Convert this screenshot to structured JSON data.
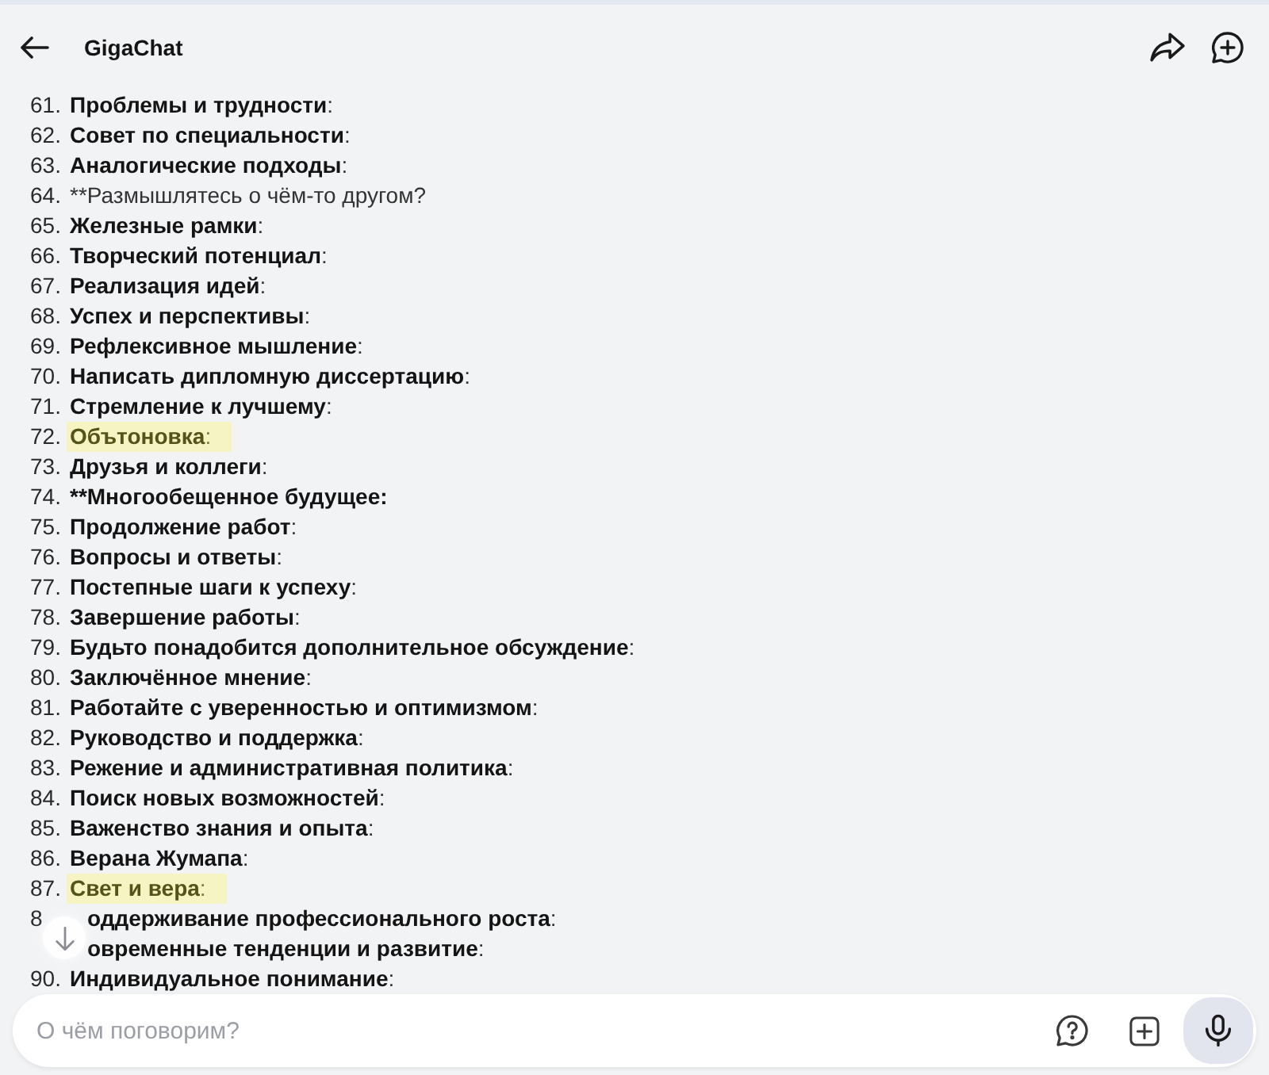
{
  "header": {
    "title": "GigaChat"
  },
  "list": [
    {
      "kind": "item",
      "number": "61.",
      "bold_text": "Проблемы и трудности",
      "plain_text": ":",
      "highlighted": false
    },
    {
      "kind": "item",
      "number": "62.",
      "bold_text": "Совет по специальности",
      "plain_text": ":",
      "highlighted": false
    },
    {
      "kind": "item",
      "number": "63.",
      "bold_text": "Аналогические подходы",
      "plain_text": ":",
      "highlighted": false
    },
    {
      "kind": "item",
      "number": "64.",
      "plain_text": "**Размышлятесь о чём-то другом?",
      "highlighted": false
    },
    {
      "kind": "item",
      "number": "65.",
      "bold_text": "Железные рамки",
      "plain_text": ":",
      "highlighted": false
    },
    {
      "kind": "item",
      "number": "66.",
      "bold_text": "Творческий потенциал",
      "plain_text": ":",
      "highlighted": false
    },
    {
      "kind": "item",
      "number": "67.",
      "bold_text": "Реализация идей",
      "plain_text": ":",
      "highlighted": false
    },
    {
      "kind": "item",
      "number": "68.",
      "bold_text": "Успех и перспективы",
      "plain_text": ":",
      "highlighted": false
    },
    {
      "kind": "item",
      "number": "69.",
      "bold_text": "Рефлексивное мышление",
      "plain_text": ":",
      "highlighted": false
    },
    {
      "kind": "item",
      "number": "70.",
      "bold_text": "Написать дипломную диссертацию",
      "plain_text": ":",
      "highlighted": false
    },
    {
      "kind": "item",
      "number": "71.",
      "bold_text": "Стремление к лучшему",
      "plain_text": ":",
      "highlighted": false
    },
    {
      "kind": "item",
      "number": "72.",
      "bold_text": "Обътоновка",
      "plain_text": ":",
      "highlighted": true
    },
    {
      "kind": "item",
      "number": "73.",
      "bold_text": "Друзья и коллеги",
      "plain_text": ":",
      "highlighted": false
    },
    {
      "kind": "item",
      "number": "74.",
      "bold_text": "**Многообещенное будущее:",
      "highlighted": false
    },
    {
      "kind": "item",
      "number": "75.",
      "bold_text": "Продолжение работ",
      "plain_text": ":",
      "highlighted": false
    },
    {
      "kind": "item",
      "number": "76.",
      "bold_text": "Вопросы и ответы",
      "plain_text": ":",
      "highlighted": false
    },
    {
      "kind": "item",
      "number": "77.",
      "bold_text": "Постепные шаги к успеху",
      "plain_text": ":",
      "highlighted": false
    },
    {
      "kind": "item",
      "number": "78.",
      "bold_text": "Завершение работы",
      "plain_text": ":",
      "highlighted": false
    },
    {
      "kind": "item",
      "number": "79.",
      "bold_text": "Будьто понадобится дополнительное обсуждение",
      "plain_text": ":",
      "highlighted": false
    },
    {
      "kind": "item",
      "number": "80.",
      "bold_text": "Заключённое мнение",
      "plain_text": ":",
      "highlighted": false
    },
    {
      "kind": "item",
      "number": "81.",
      "bold_text": "Работайте с уверенностью и оптимизмом",
      "plain_text": ":",
      "highlighted": false
    },
    {
      "kind": "item",
      "number": "82.",
      "bold_text": "Руководство и поддержка",
      "plain_text": ":",
      "highlighted": false
    },
    {
      "kind": "item",
      "number": "83.",
      "bold_text": "Режение и административная политика",
      "plain_text": ":",
      "highlighted": false
    },
    {
      "kind": "item",
      "number": "84.",
      "bold_text": "Поиск новых возможностей",
      "plain_text": ":",
      "highlighted": false
    },
    {
      "kind": "item",
      "number": "85.",
      "bold_text": "Важенство знания и опыта",
      "plain_text": ":",
      "highlighted": false
    },
    {
      "kind": "item",
      "number": "86.",
      "bold_text": "Верана Жумапа",
      "plain_text": ":",
      "highlighted": false
    },
    {
      "kind": "item",
      "number": "87.",
      "bold_text": "Свет и вера",
      "plain_text": ":",
      "highlighted": true
    },
    {
      "kind": "cut",
      "number": "8",
      "bold_text": "оддерживание профессионального роста",
      "plain_text": ":",
      "highlighted": false
    },
    {
      "kind": "cut",
      "bold_text": "овременные тенденции и развитие",
      "plain_text": ":",
      "highlighted": false
    },
    {
      "kind": "item",
      "number": "90.",
      "bold_text": "Индивидуальное понимание",
      "plain_text": ":",
      "highlighted": false
    }
  ],
  "composer": {
    "placeholder": "О чём поговорим?"
  }
}
